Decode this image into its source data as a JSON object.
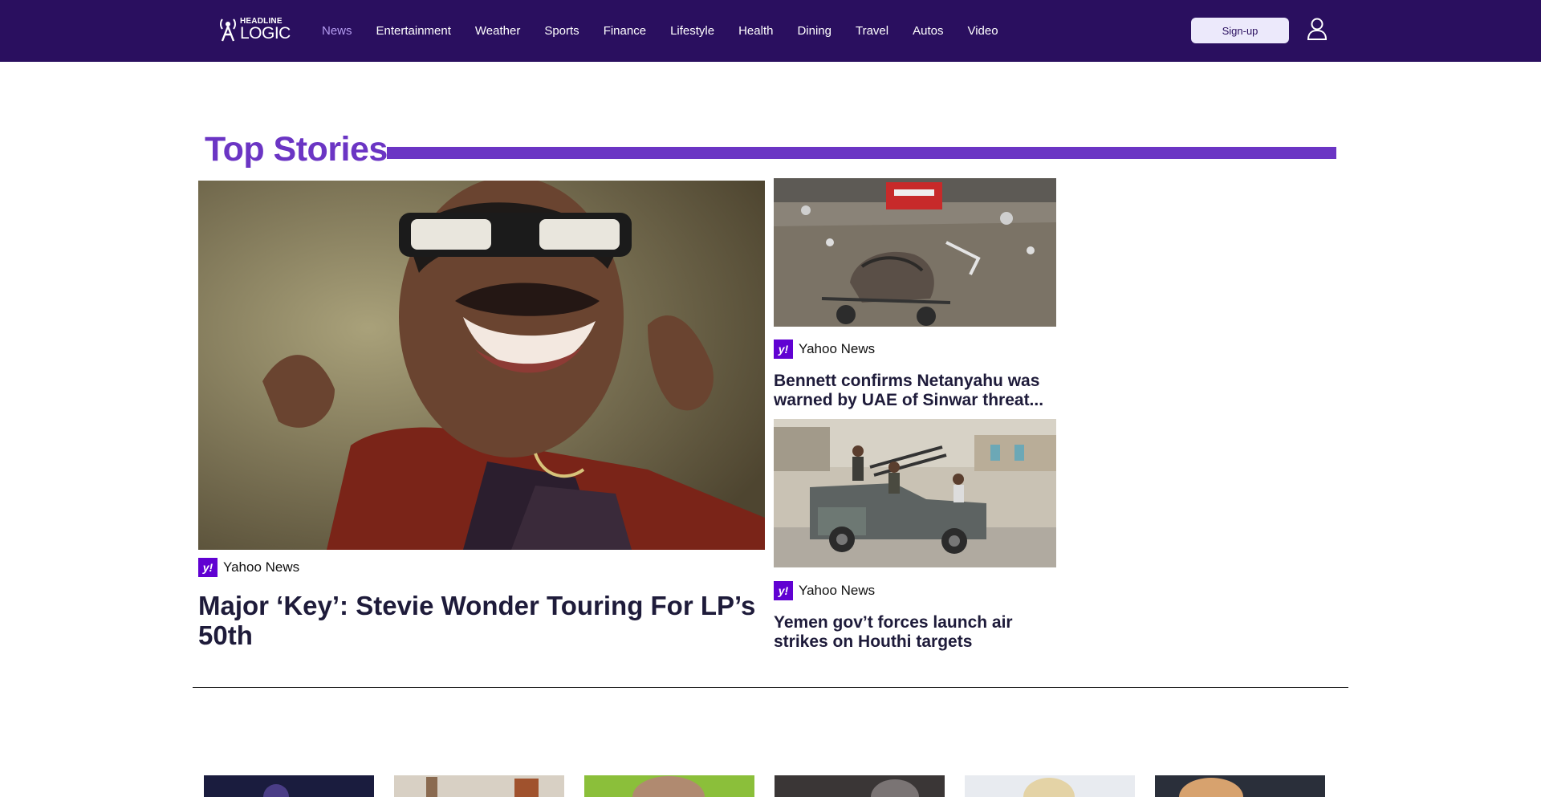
{
  "header": {
    "logo": {
      "top": "HEADLINE",
      "bottom": "LOGIC"
    },
    "nav": [
      {
        "label": "News",
        "active": true
      },
      {
        "label": "Entertainment"
      },
      {
        "label": "Weather"
      },
      {
        "label": "Sports"
      },
      {
        "label": "Finance"
      },
      {
        "label": "Lifestyle"
      },
      {
        "label": "Health"
      },
      {
        "label": "Dining"
      },
      {
        "label": "Travel"
      },
      {
        "label": "Autos"
      },
      {
        "label": "Video"
      }
    ],
    "signup_label": "Sign-up",
    "user_icon": "user-icon",
    "colors": {
      "bar": "#2a0f5f",
      "active_nav": "#b49cf0"
    }
  },
  "top_stories": {
    "title": "Top Stories",
    "accent": "#6b35c4",
    "main": {
      "source": "Yahoo News",
      "source_icon": "y!",
      "headline": "Major ‘Key’: Stevie Wonder Touring For LP’s 50th"
    },
    "side": [
      {
        "source": "Yahoo News",
        "source_icon": "y!",
        "headline": "Bennett confirms Netanyahu was warned by UAE of Sinwar threat..."
      },
      {
        "source": "Yahoo News",
        "source_icon": "y!",
        "headline": "Yemen gov’t forces launch air strikes on Houthi targets"
      }
    ]
  }
}
